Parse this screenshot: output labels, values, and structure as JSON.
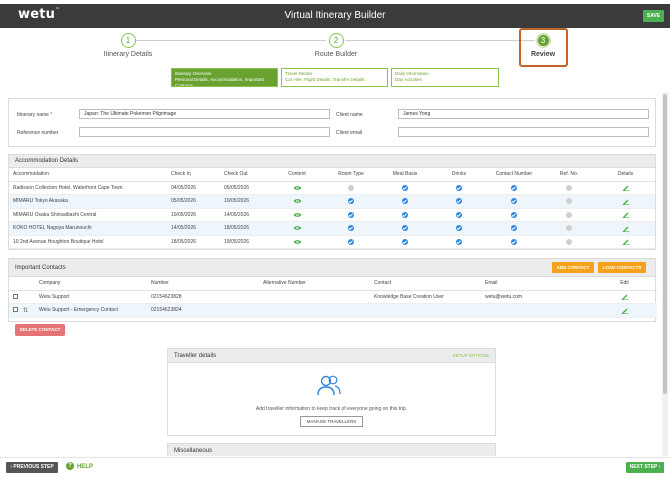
{
  "header": {
    "logo": "wetu",
    "title": "Virtual Itinerary Builder",
    "save_label": "SAVE"
  },
  "steps": [
    {
      "number": "1",
      "label": "Itinerary Details"
    },
    {
      "number": "2",
      "label": "Route Builder"
    },
    {
      "number": "3",
      "label": "Review"
    }
  ],
  "subtabs": [
    {
      "title": "Itinerary Overview",
      "desc": "Personal Details, Accommodation, Important Contacts"
    },
    {
      "title": "Travel Details",
      "desc": "Car Hire, Flight Details, Transfer Details"
    },
    {
      "title": "Daily Information",
      "desc": "Day Activities"
    }
  ],
  "form": {
    "itinerary_name_label": "Itinerary name",
    "itinerary_name_required": "*",
    "itinerary_name_value": "Japan: The Ultimate Pokemon Pilgrimage",
    "client_name_label": "Client name",
    "client_name_value": "James Yong",
    "reference_label": "Reference number",
    "reference_value": "",
    "client_email_label": "Client email",
    "client_email_value": ""
  },
  "accommodation": {
    "title": "Accommodation Details",
    "columns": [
      "Accommodation",
      "Check In",
      "Check Out",
      "Content",
      "Room Type",
      "Meal Basis",
      "Drinks",
      "Contact Number",
      "Ref. No.",
      "Details"
    ],
    "rows": [
      {
        "name": "Radisson Collection Hotel, Waterfront Cape Town",
        "check_in": "04/05/2026",
        "check_out": "05/05/2026",
        "room": "grey",
        "meal": "blue",
        "drinks": "blue",
        "contact": "blue",
        "ref": "grey"
      },
      {
        "name": "MIMARU Tokyo Akasaka",
        "check_in": "05/05/2026",
        "check_out": "10/05/2026",
        "room": "blue",
        "meal": "blue",
        "drinks": "blue",
        "contact": "blue",
        "ref": "grey"
      },
      {
        "name": "MIMARU Osaka Shinsaibashi Central",
        "check_in": "10/05/2026",
        "check_out": "14/05/2026",
        "room": "blue",
        "meal": "blue",
        "drinks": "blue",
        "contact": "blue",
        "ref": "grey"
      },
      {
        "name": "KOKO HOTEL Nagoya Marunouchi",
        "check_in": "14/05/2026",
        "check_out": "18/05/2026",
        "room": "blue",
        "meal": "blue",
        "drinks": "blue",
        "contact": "blue",
        "ref": "grey"
      },
      {
        "name": "10 2nd Avenue Houghton Boutique Hotel",
        "check_in": "18/05/2026",
        "check_out": "19/05/2026",
        "room": "blue",
        "meal": "blue",
        "drinks": "blue",
        "contact": "blue",
        "ref": "grey"
      }
    ]
  },
  "contacts": {
    "title": "Important Contacts",
    "add_label": "ADD CONTACT",
    "load_label": "LOAD CONTACTS",
    "columns": [
      "Company",
      "Number",
      "Alternative Number",
      "Contact",
      "Email",
      "Edit"
    ],
    "rows": [
      {
        "company": "Wetu Support",
        "number": "02154623828",
        "alt": "",
        "contact": "Knowledge Base Creation User",
        "email": "wetu@wetu.com"
      },
      {
        "company": "Wetu Support - Emergency Contact",
        "number": "02154623824",
        "alt": "",
        "contact": "",
        "email": ""
      }
    ],
    "delete_label": "DELETE CONTACT"
  },
  "travellers": {
    "title": "Traveller details",
    "setup_label": "SETUP OPTIONS",
    "message": "Add traveller information to keep track of everyone going on this trip.",
    "manage_label": "MANAGE TRAVELLERS"
  },
  "misc": {
    "title": "Miscellaneous"
  },
  "footer": {
    "prev_label": "PREVIOUS STEP",
    "help_label": "HELP",
    "next_label": "NEXT STEP"
  },
  "colors": {
    "green": "#6aa232",
    "orange": "#f5a21b",
    "blue": "#2e86de",
    "red": "#e57373",
    "dark": "#3b3b3b"
  }
}
